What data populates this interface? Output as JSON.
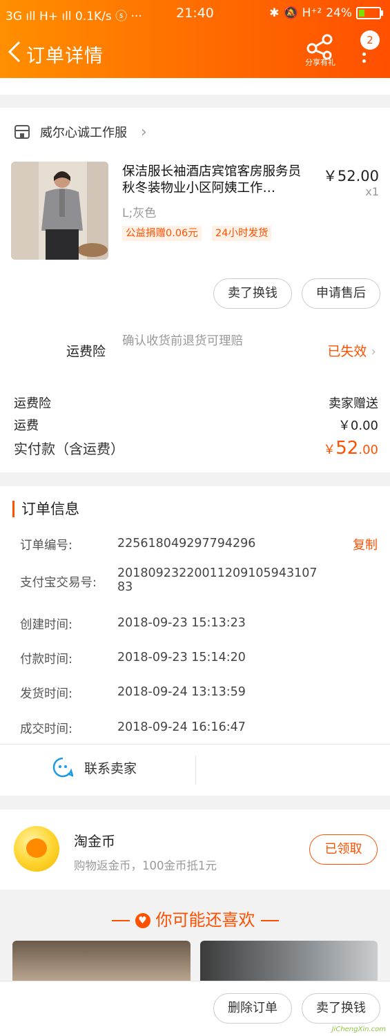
{
  "status_bar": {
    "left": "3G ıll H+ ıll 0.1K/s ⓢ ···",
    "time": "21:40",
    "battery": "24%"
  },
  "nav": {
    "back_label": "<",
    "title": "订单详情",
    "share_label": "分享有礼",
    "badge_count": "2"
  },
  "shop": {
    "name": "威尔心诚工作服",
    "product_title": "保洁服长袖酒店宾馆客房服务员秋冬装物业小区阿姨工作…",
    "price": "￥52.00",
    "quantity": "x1",
    "sku": "L;灰色",
    "tags": [
      "公益捐赠0.06元",
      "24小时发货"
    ],
    "buttons": {
      "sell": "卖了换钱",
      "after_sale": "申请售后"
    },
    "insurance_label": "运费险",
    "insurance_desc": "确认收货前退货可理赔",
    "insurance_status": "已失效",
    "fees": [
      {
        "label": "运费险",
        "value": "卖家赠送"
      },
      {
        "label": "运费",
        "value": "￥0.00"
      }
    ],
    "total_label": "实付款（含运费）",
    "total_currency": "￥",
    "total_int": "52",
    "total_dec": ".00"
  },
  "order_info": {
    "title": "订单信息",
    "copy_label": "复制",
    "rows": [
      {
        "label": "订单编号:",
        "value": "225618049297794296"
      },
      {
        "label": "支付宝交易号:",
        "value": "2018092322001120910594310783"
      },
      {
        "label": "创建时间:",
        "value": "2018-09-23 15:13:23"
      },
      {
        "label": "付款时间:",
        "value": "2018-09-23 15:14:20"
      },
      {
        "label": "发货时间:",
        "value": "2018-09-24 13:13:59"
      },
      {
        "label": "成交时间:",
        "value": "2018-09-24 16:16:47"
      }
    ],
    "contact_label": "联系卖家"
  },
  "coin": {
    "title": "淘金币",
    "desc": "购物返金币，100金币抵1元",
    "button": "已领取"
  },
  "recommend": {
    "title": "你可能还喜欢"
  },
  "bottom": {
    "delete": "删除订单",
    "sell": "卖了换钱"
  },
  "watermark": "JiChengXin.com"
}
